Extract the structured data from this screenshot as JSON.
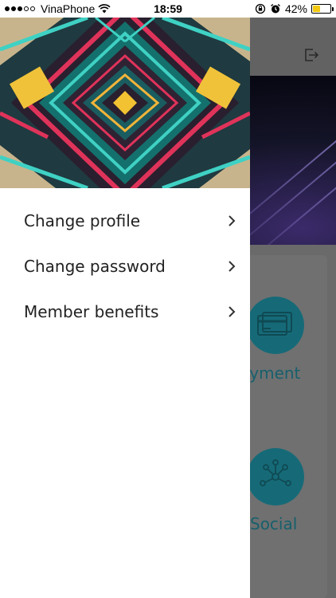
{
  "status_bar": {
    "signal_full": 3,
    "signal_empty": 2,
    "carrier": "VinaPhone",
    "time": "18:59",
    "battery_percent": "42%",
    "battery_level": 0.42,
    "icons": [
      "wifi-icon",
      "orientation-lock-icon",
      "alarm-icon",
      "battery-icon"
    ]
  },
  "drawer": {
    "menu_items": [
      {
        "label": "Change profile",
        "icon": "chevron-right-icon"
      },
      {
        "label": "Change password",
        "icon": "chevron-right-icon"
      },
      {
        "label": "Member benefits",
        "icon": "chevron-right-icon"
      }
    ]
  },
  "background_app": {
    "header_icon": "logout-icon",
    "tiles": [
      {
        "label": "Payment",
        "visible_text": "ayment",
        "icon": "credit-card-icon"
      },
      {
        "label": "Social",
        "visible_text": "Social",
        "icon": "network-icon"
      }
    ],
    "accent_color": "#166a78"
  },
  "colors": {
    "drawer_bg": "#ffffff",
    "overlay": "#5c5c5c",
    "battery": "#f4c911"
  }
}
